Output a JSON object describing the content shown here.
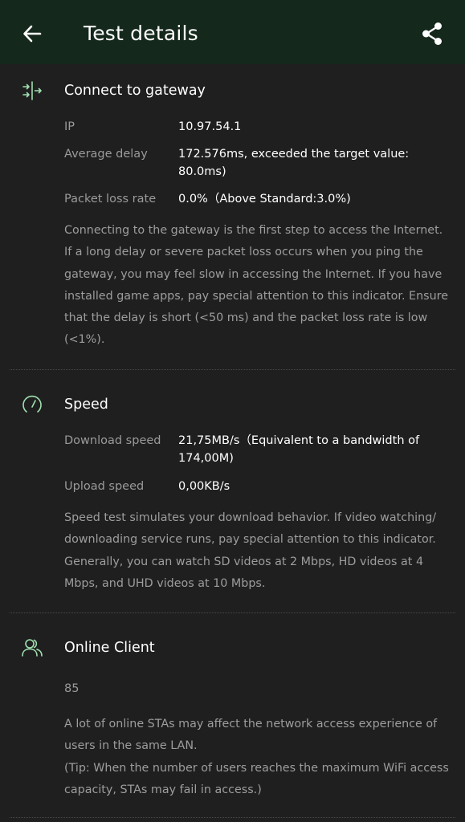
{
  "header": {
    "title": "Test details",
    "back_icon": "arrow-left-icon",
    "share_icon": "share-icon"
  },
  "gateway": {
    "icon": "connect-gateway-icon",
    "title": "Connect to gateway",
    "rows": [
      {
        "label": "IP",
        "value": "10.97.54.1"
      },
      {
        "label": "Average delay",
        "value": "172.576ms, exceeded the target value: 80.0ms)"
      },
      {
        "label": "Packet loss rate",
        "value": "0.0%（Above Standard:3.0%)"
      }
    ],
    "description": "Connecting to the gateway is the first step to access the Internet. If a long delay or severe packet loss occurs when you ping the gateway, you may feel slow in accessing the Internet. If you have installed game apps, pay special attention to this indicator. Ensure that the delay is short (<50 ms) and the packet loss rate is low (<1%)."
  },
  "speed": {
    "icon": "speedometer-icon",
    "title": "Speed",
    "rows": [
      {
        "label": "Download speed",
        "value": "21,75MB/s（Equivalent to a bandwidth of 174,00M)"
      },
      {
        "label": "Upload speed",
        "value": "0,00KB/s"
      }
    ],
    "description": "Speed test simulates your download behavior. If video watching/ downloading service runs, pay special attention to this indicator. Generally, you can watch SD videos at 2 Mbps, HD videos at 4 Mbps, and UHD videos at 10 Mbps."
  },
  "clients": {
    "icon": "users-icon",
    "title": "Online Client",
    "count": "85",
    "description": "A lot of online STAs may affect the network access experience of users in the same LAN.",
    "tip": "(Tip: When the number of users reaches the maximum WiFi access capacity, STAs may fail in access.)"
  },
  "colors": {
    "appbar": "#15281c",
    "background": "#1f1f1f",
    "accent": "#9fe0b0"
  }
}
